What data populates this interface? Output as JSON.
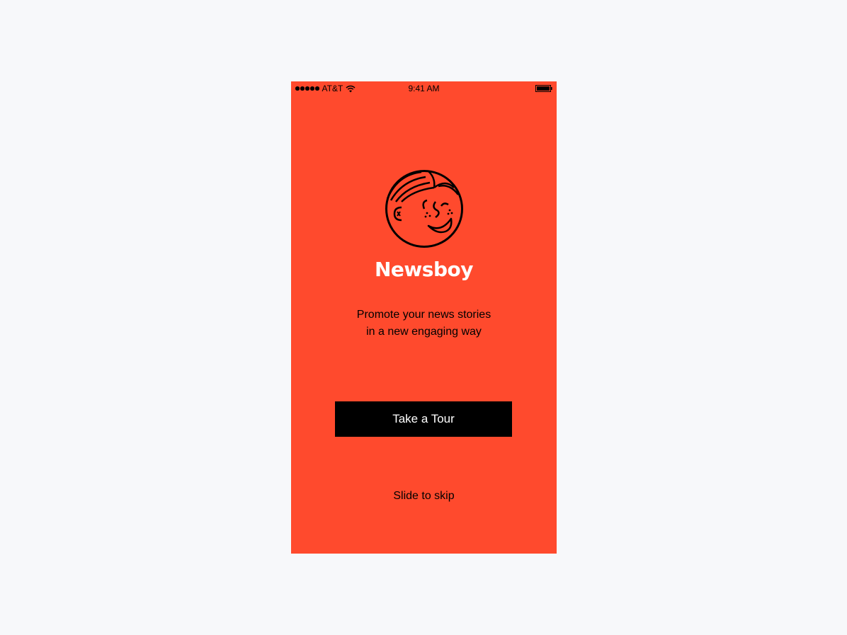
{
  "status_bar": {
    "carrier": "AT&T",
    "time": "9:41 AM",
    "signal_icon": "signal-dots-icon",
    "wifi_icon": "wifi-icon",
    "battery_icon": "battery-icon"
  },
  "logo": {
    "icon": "newsboy-face-icon"
  },
  "app": {
    "name": "Newsboy",
    "tagline_line1": "Promote your news stories",
    "tagline_line2": "in a new engaging way"
  },
  "actions": {
    "tour_label": "Take a Tour",
    "skip_label": "Slide to skip"
  },
  "colors": {
    "background": "#ff4a2d",
    "button": "#000000",
    "title": "#ffffff",
    "page": "#f7f8fa"
  }
}
